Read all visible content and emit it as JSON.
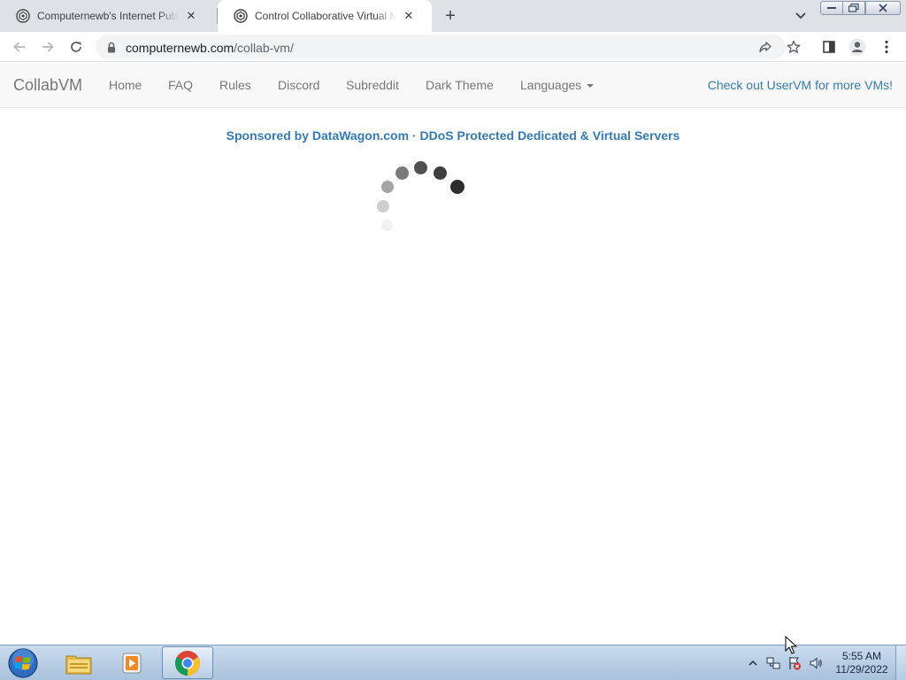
{
  "browser": {
    "tabs": [
      {
        "title": "Computernewb's Internet Pub Hu",
        "active": false
      },
      {
        "title": "Control Collaborative Virtual Mac",
        "active": true
      }
    ],
    "new_tab": "+",
    "address": {
      "host": "computernewb.com",
      "path": "/collab-vm/"
    }
  },
  "site": {
    "brand": "CollabVM",
    "nav": [
      "Home",
      "FAQ",
      "Rules",
      "Discord",
      "Subreddit",
      "Dark Theme",
      "Languages"
    ],
    "nav_right": "Check out UserVM for more VMs!",
    "sponsor": "Sponsored by DataWagon.com · DDoS Protected Dedicated & Virtual Servers",
    "colors": {
      "link": "#337ab7",
      "nav_text": "#777777",
      "navbar_bg": "#f8f8f8"
    }
  },
  "taskbar": {
    "pinned": [
      "windows-explorer-icon",
      "media-player-icon",
      "chrome-icon"
    ],
    "active_app": "chrome-icon",
    "tray": [
      "show-hidden-icons",
      "network-icon",
      "action-center-icon",
      "volume-icon"
    ],
    "clock": {
      "time": "5:55 AM",
      "date": "11/29/2022"
    }
  }
}
